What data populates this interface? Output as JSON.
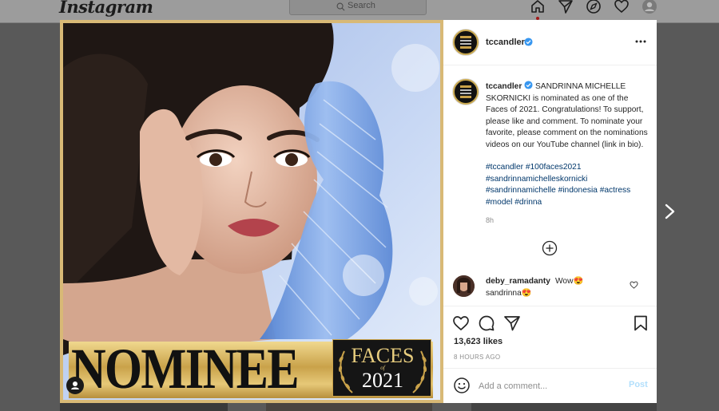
{
  "nav": {
    "logo": "Instagram",
    "search_placeholder": "Search"
  },
  "post": {
    "author": "tccandler",
    "caption_text": "SANDRINNA MICHELLE SKORNICKI is nominated as one of the Faces of 2021.  Congratulations!  To support, please like and comment.  To nominate your favorite,  please comment on the nominations videos on our YouTube channel (link in bio).",
    "hashtags": "#tccandler #100faces2021 #sandrinnamichelleskornicki #sandrinnamichelle #indonesia #actress #model #drinna",
    "caption_age": "8h",
    "likes": "13,623 likes",
    "time": "8 HOURS AGO",
    "image": {
      "banner_word": "NOMINEE",
      "faces_word": "FACES",
      "faces_of": "of",
      "faces_year": "2021"
    }
  },
  "comment": {
    "user": "deby_ramadanty",
    "text": "Wow😍",
    "text2": "sandrinna😍"
  },
  "composer": {
    "placeholder": "Add a comment...",
    "post_label": "Post"
  },
  "colors": {
    "link": "#00376b",
    "verified": "#3897f0",
    "post_disabled": "#b2dffc",
    "gold": "#c9a24a"
  }
}
